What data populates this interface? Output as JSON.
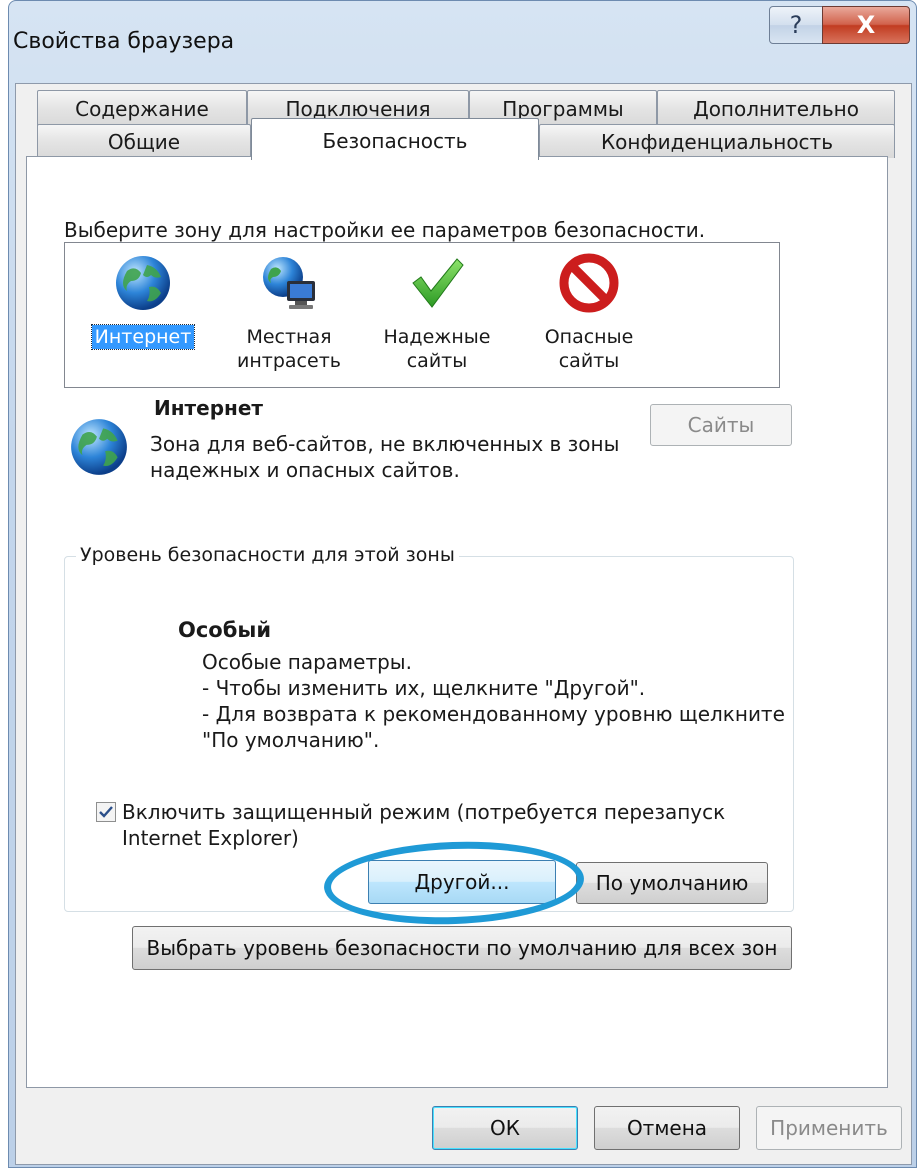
{
  "window": {
    "title": "Свойства браузера",
    "help_glyph": "?",
    "close_glyph": "X"
  },
  "tabs": {
    "row1": [
      "Содержание",
      "Подключения",
      "Программы",
      "Дополнительно"
    ],
    "row2": [
      "Общие",
      "Безопасность",
      "Конфиденциальность"
    ],
    "active": "Безопасность"
  },
  "security": {
    "zone_prompt": "Выберите зону для настройки ее параметров безопасности.",
    "zones": [
      {
        "label": "Интернет",
        "icon": "globe-icon",
        "selected": true
      },
      {
        "label": "Местная\nинтрасеть",
        "icon": "intranet-icon",
        "selected": false
      },
      {
        "label": "Надежные\nсайты",
        "icon": "checkmark-icon",
        "selected": false
      },
      {
        "label": "Опасные\nсайты",
        "icon": "forbidden-icon",
        "selected": false
      }
    ],
    "zone_title": "Интернет",
    "zone_desc_line1": "Зона для веб-сайтов, не включенных в зоны",
    "zone_desc_line2": "надежных и опасных сайтов.",
    "sites_button": "Сайты",
    "level_group_label": "Уровень безопасности для этой зоны",
    "level_name": "Особый",
    "level_lines": [
      "Особые параметры.",
      "- Чтобы изменить их, щелкните \"Другой\".",
      "- Для возврата к рекомендованному уровню щелкните",
      "\"По умолчанию\"."
    ],
    "protected_mode_checked": true,
    "protected_mode_line1": "Включить защищенный режим (потребуется перезапуск",
    "protected_mode_line2": "Internet Explorer)",
    "custom_button": "Другой...",
    "default_button": "По умолчанию",
    "reset_all_button": "Выбрать уровень безопасности по умолчанию для всех зон"
  },
  "footer": {
    "ok": "ОК",
    "cancel": "Отмена",
    "apply": "Применить"
  },
  "colors": {
    "annotation": "#1f9ad6",
    "selection": "#3399ff"
  }
}
